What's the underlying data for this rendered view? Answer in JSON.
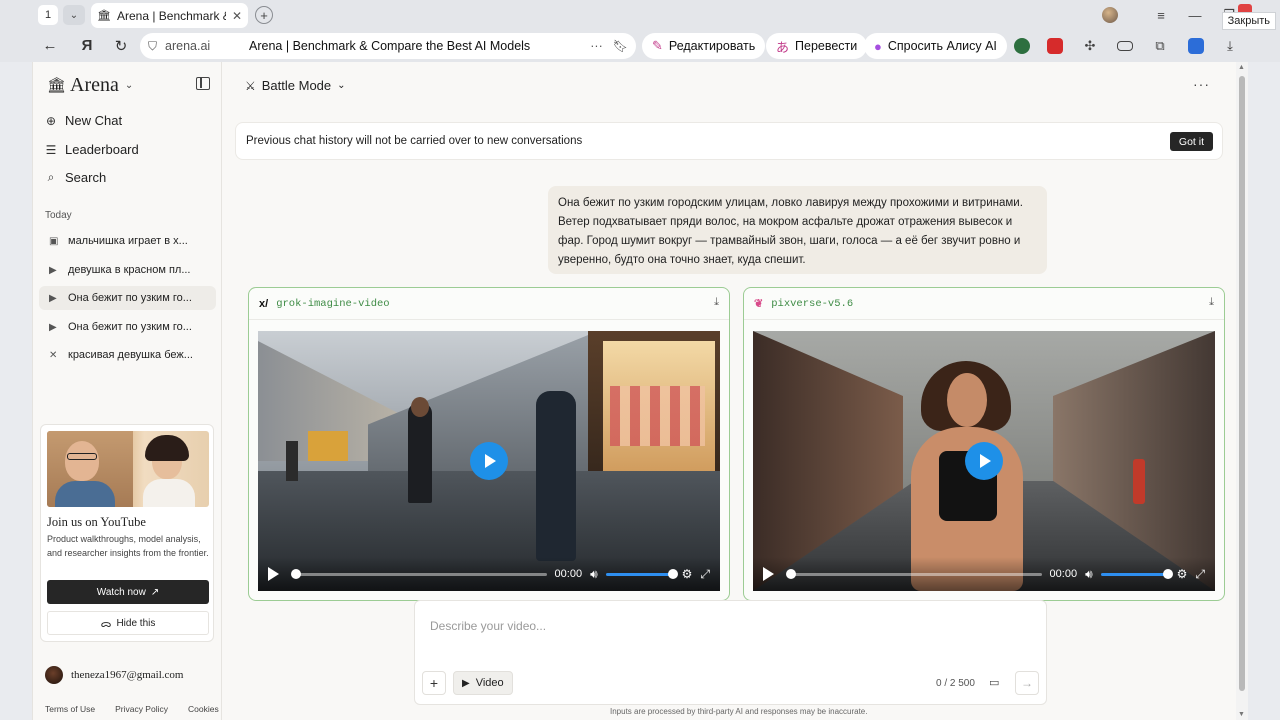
{
  "browser": {
    "tab_count": "1",
    "tab_title": "Arena | Benchmark & C",
    "address_domain": "arena.ai",
    "address_title": "Arena | Benchmark & Compare the Best AI Models",
    "pills": [
      "Редактировать",
      "Перевести",
      "Спросить Алису AI"
    ],
    "close_tooltip": "Закрыть"
  },
  "sidebar": {
    "logo": "Arena",
    "nav": [
      {
        "label": "New Chat",
        "icon": "plus-circle-icon"
      },
      {
        "label": "Leaderboard",
        "icon": "list-icon"
      },
      {
        "label": "Search",
        "icon": "search-icon"
      }
    ],
    "section": "Today",
    "history": [
      "мальчишка играет в х...",
      "девушка в красном пл...",
      "Она бежит по узким го...",
      "Она бежит по узким го...",
      "красивая девушка беж..."
    ],
    "youtube": {
      "title": "Join us on YouTube",
      "desc": "Product walkthroughs, model analysis, and researcher insights from the frontier.",
      "watch": "Watch now",
      "hide": "Hide this"
    },
    "user_email": "theneza1967@gmail.com",
    "footer": [
      "Terms of Use",
      "Privacy Policy",
      "Cookies"
    ]
  },
  "main": {
    "mode": "Battle Mode",
    "notice": "Previous chat history will not be carried over to new conversations",
    "gotit": "Got it",
    "user_message": "Она бежит по узким городским улицам, ловко лавируя между прохожими и витринами. Ветер подхватывает пряди волос, на мокром асфальте дрожат отражения вывесок и фар. Город шумит вокруг — трамвайный звон, шаги, голоса — а её бег звучит ровно и уверенно, будто она точно знает, куда спешит.",
    "models": [
      {
        "name": "grok-imagine-video",
        "time": "00:00",
        "progress": 0,
        "volume": 1.0
      },
      {
        "name": "pixverse-v5.6",
        "time": "00:00",
        "progress": 0,
        "volume": 1.0
      }
    ],
    "composer": {
      "placeholder": "Describe your video...",
      "mode": "Video",
      "count": "0 / 2 500"
    },
    "disclaimer": "Inputs are processed by third-party AI and responses may be inaccurate."
  }
}
